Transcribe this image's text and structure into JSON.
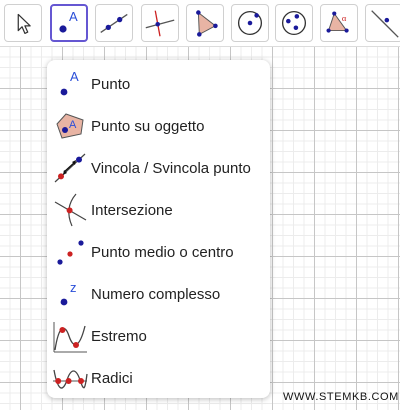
{
  "colors": {
    "accent": "#6557d2",
    "point_blue": "#1a1a9a",
    "point_red": "#cc2222",
    "letter_blue": "#2a4ed8",
    "polygon_fill": "#e8b4a4"
  },
  "toolbar": {
    "tools": [
      {
        "icon": "move-arrow-icon",
        "active": false
      },
      {
        "icon": "point-icon",
        "active": true
      },
      {
        "icon": "line-icon",
        "active": false
      },
      {
        "icon": "perpendicular-line-icon",
        "active": false
      },
      {
        "icon": "polygon-icon",
        "active": false
      },
      {
        "icon": "circle-with-center-icon",
        "active": false
      },
      {
        "icon": "circle-through-points-icon",
        "active": false
      },
      {
        "icon": "angle-icon",
        "active": false
      },
      {
        "icon": "reflect-line-icon",
        "active": false
      }
    ]
  },
  "menu": {
    "items": [
      {
        "label": "Punto",
        "icon": "point-icon"
      },
      {
        "label": "Punto su oggetto",
        "icon": "point-on-object-icon"
      },
      {
        "label": "Vincola / Svincola punto",
        "icon": "attach-detach-point-icon"
      },
      {
        "label": "Intersezione",
        "icon": "intersection-icon"
      },
      {
        "label": "Punto medio o centro",
        "icon": "midpoint-icon"
      },
      {
        "label": "Numero complesso",
        "icon": "complex-number-icon"
      },
      {
        "label": "Estremo",
        "icon": "extremum-icon"
      },
      {
        "label": "Radici",
        "icon": "roots-icon"
      }
    ]
  },
  "watermark": "WWW.STEMKB.COM"
}
